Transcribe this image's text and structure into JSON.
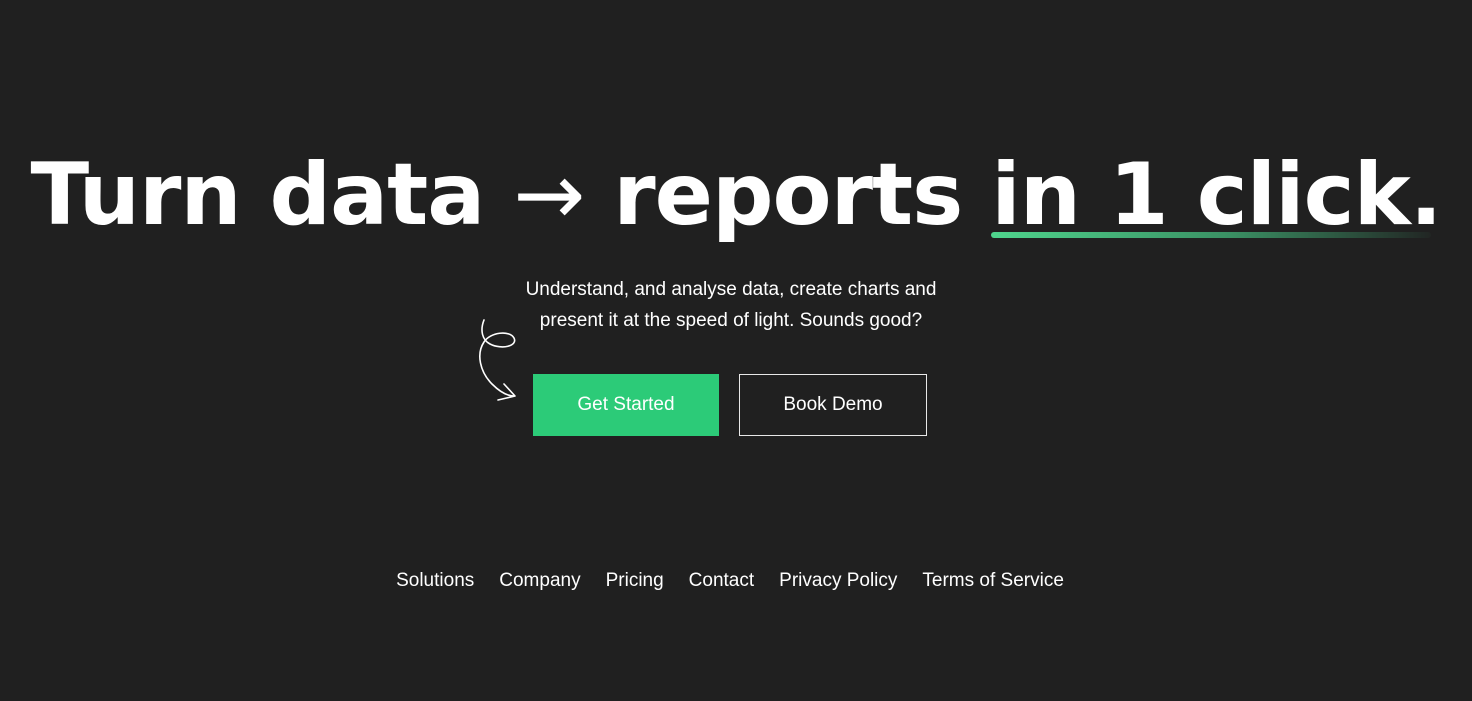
{
  "hero": {
    "title_part1": "Turn data",
    "title_arrow": "→",
    "title_part2": "reports",
    "title_highlight": "in 1 click.",
    "subtitle_line1": "Understand, and analyse data, create charts and",
    "subtitle_line2": "present it at the speed of light. Sounds good?"
  },
  "buttons": {
    "primary_label": "Get Started",
    "secondary_label": "Book Demo"
  },
  "footer": {
    "links": [
      "Solutions",
      "Company",
      "Pricing",
      "Contact",
      "Privacy Policy",
      "Terms of Service"
    ]
  },
  "colors": {
    "background": "#202020",
    "accent": "#2ccb78",
    "text": "#ffffff"
  },
  "icons": {
    "decorative_arrow": "hand-drawn-squiggle-arrow-icon"
  }
}
